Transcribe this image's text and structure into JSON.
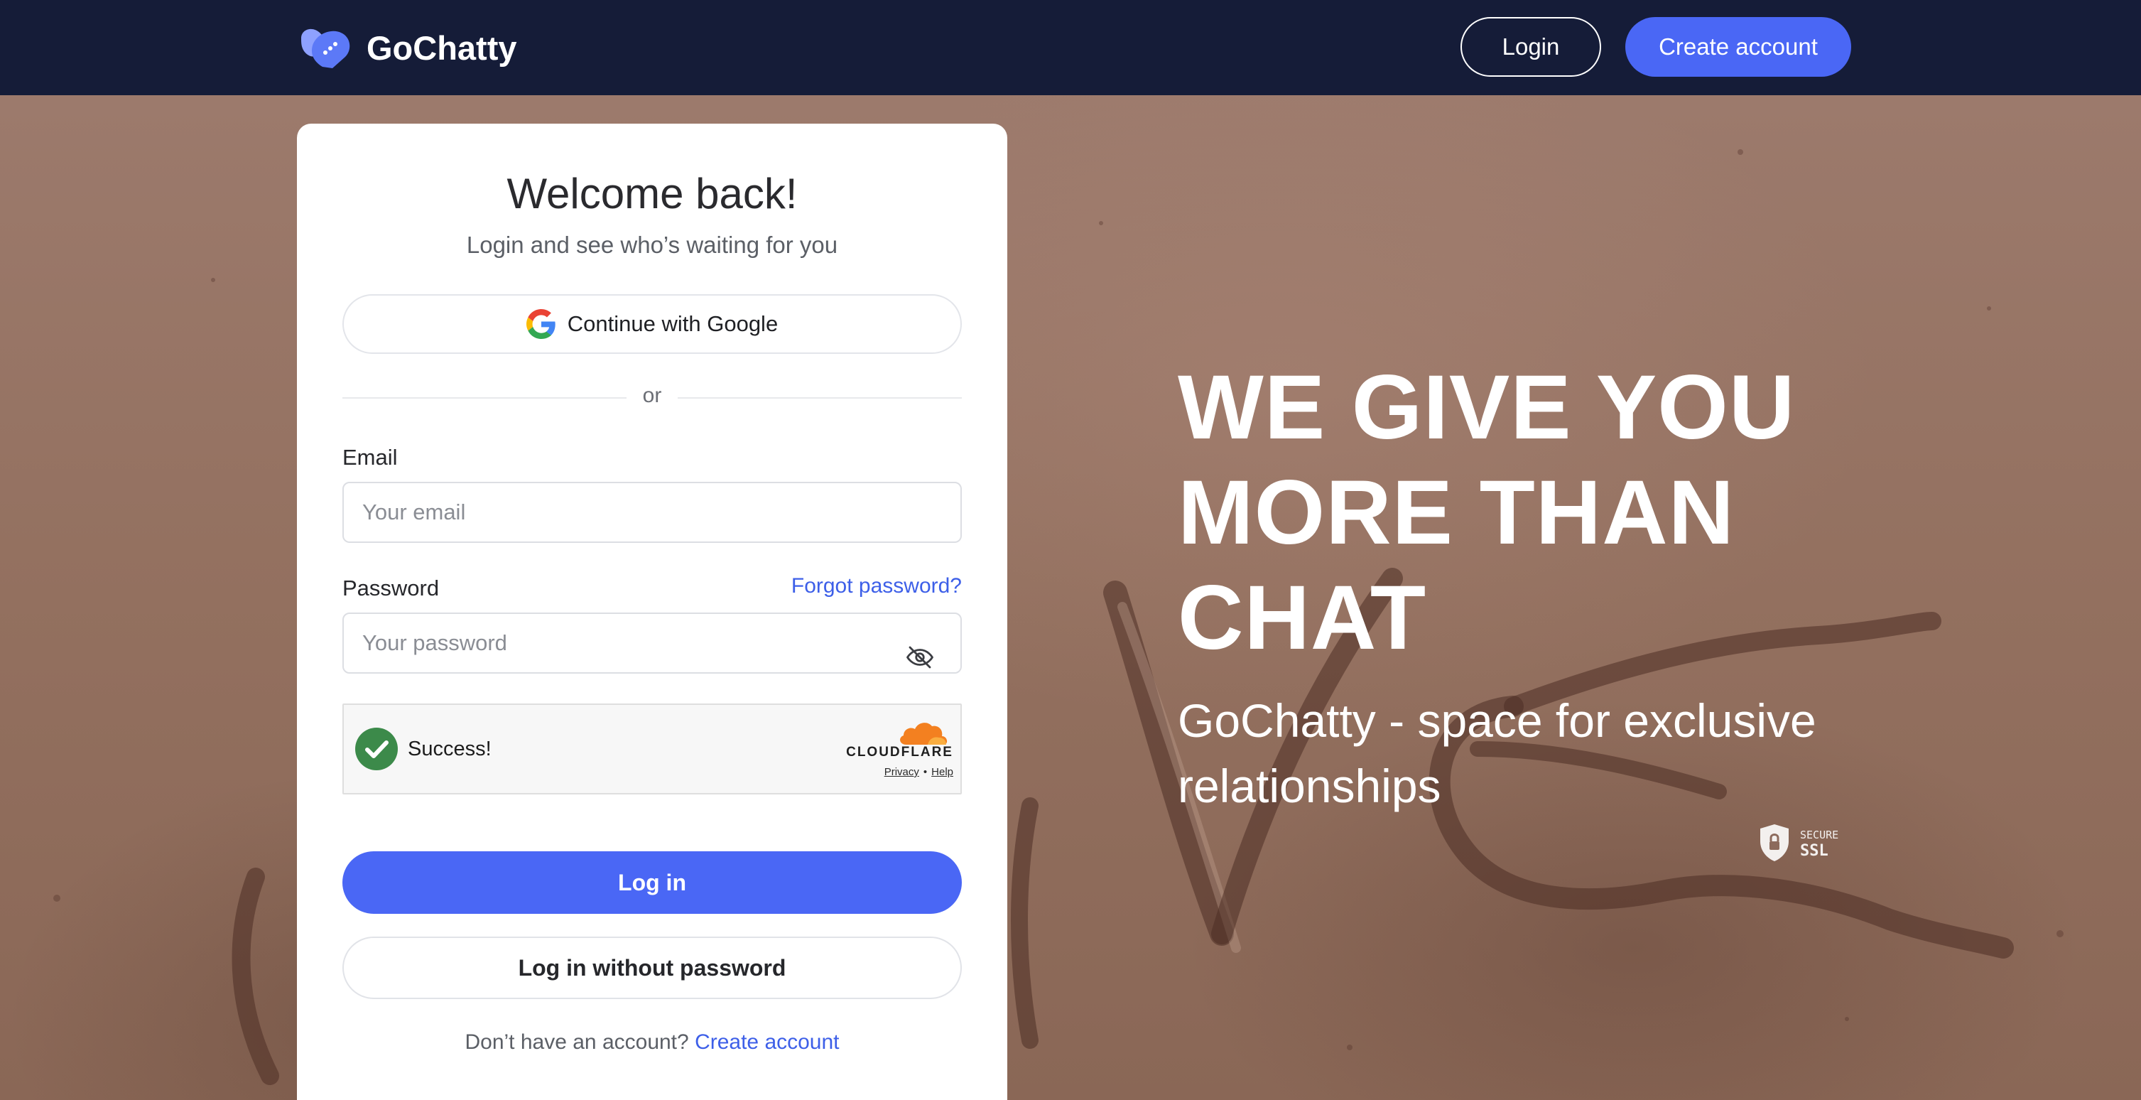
{
  "header": {
    "brand_name": "GoChatty",
    "login_label": "Login",
    "create_account_label": "Create account"
  },
  "login_card": {
    "title": "Welcome back!",
    "subtitle": "Login and see who’s waiting for you",
    "google_button_label": "Continue with Google",
    "divider_text": "or",
    "email_label": "Email",
    "email_placeholder": "Your email",
    "email_value": "",
    "password_label": "Password",
    "forgot_password_label": "Forgot password?",
    "password_placeholder": "Your password",
    "password_value": "",
    "captcha": {
      "status_text": "Success!",
      "provider": "CLOUDFLARE",
      "privacy_label": "Privacy",
      "separator": "•",
      "help_label": "Help"
    },
    "login_button_label": "Log in",
    "passwordless_button_label": "Log in without password",
    "signup_prompt": "Don’t have an account?",
    "signup_link_label": "Create account"
  },
  "hero": {
    "headline_lines": [
      "WE GIVE YOU",
      "MORE THAN",
      "CHAT"
    ],
    "tagline_lines": [
      "GoChatty - space for exclusive",
      "relationships"
    ],
    "ssl_badge_top": "SECURE",
    "ssl_badge_bottom": "SSL"
  },
  "icons": {
    "logo": "heart-chat-logo-icon",
    "google": "google-icon",
    "password_toggle": "eye-slash-icon",
    "captcha_check": "checkmark-circle-icon",
    "cloudflare": "cloudflare-cloud-icon",
    "ssl": "shield-lock-icon"
  },
  "colors": {
    "header_bg": "#151c38",
    "primary": "#4a67f5",
    "link": "#3d5fe8",
    "success": "#3c8a4a",
    "cloudflare_orange": "#f38020"
  }
}
